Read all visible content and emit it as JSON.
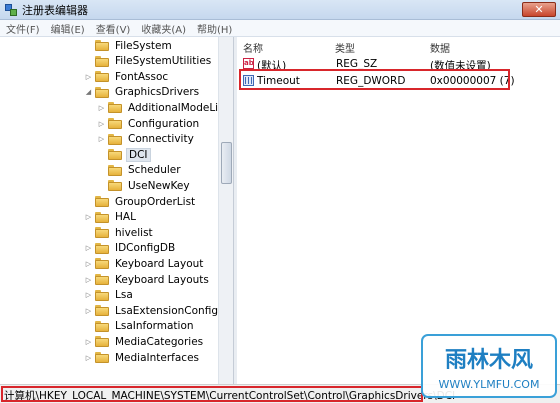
{
  "window": {
    "title": "注册表编辑器",
    "close_label": "✕"
  },
  "menu": [
    "文件(F)",
    "编辑(E)",
    "查看(V)",
    "收藏夹(A)",
    "帮助(H)"
  ],
  "tree": [
    {
      "label": "FileSystem",
      "level": 1,
      "expander": "",
      "selected": false
    },
    {
      "label": "FileSystemUtilities",
      "level": 1,
      "expander": "",
      "selected": false
    },
    {
      "label": "FontAssoc",
      "level": 1,
      "expander": "▷",
      "selected": false
    },
    {
      "label": "GraphicsDrivers",
      "level": 1,
      "expander": "◢",
      "selected": false
    },
    {
      "label": "AdditionalModeLists",
      "level": 2,
      "expander": "▷",
      "selected": false
    },
    {
      "label": "Configuration",
      "level": 2,
      "expander": "▷",
      "selected": false
    },
    {
      "label": "Connectivity",
      "level": 2,
      "expander": "▷",
      "selected": false
    },
    {
      "label": "DCI",
      "level": 2,
      "expander": "",
      "selected": true
    },
    {
      "label": "Scheduler",
      "level": 2,
      "expander": "",
      "selected": false
    },
    {
      "label": "UseNewKey",
      "level": 2,
      "expander": "",
      "selected": false
    },
    {
      "label": "GroupOrderList",
      "level": 1,
      "expander": "",
      "selected": false
    },
    {
      "label": "HAL",
      "level": 1,
      "expander": "▷",
      "selected": false
    },
    {
      "label": "hivelist",
      "level": 1,
      "expander": "",
      "selected": false
    },
    {
      "label": "IDConfigDB",
      "level": 1,
      "expander": "▷",
      "selected": false
    },
    {
      "label": "Keyboard Layout",
      "level": 1,
      "expander": "▷",
      "selected": false
    },
    {
      "label": "Keyboard Layouts",
      "level": 1,
      "expander": "▷",
      "selected": false
    },
    {
      "label": "Lsa",
      "level": 1,
      "expander": "▷",
      "selected": false
    },
    {
      "label": "LsaExtensionConfig",
      "level": 1,
      "expander": "▷",
      "selected": false
    },
    {
      "label": "LsaInformation",
      "level": 1,
      "expander": "",
      "selected": false
    },
    {
      "label": "MediaCategories",
      "level": 1,
      "expander": "▷",
      "selected": false
    },
    {
      "label": "MediaInterfaces",
      "level": 1,
      "expander": "▷",
      "selected": false
    }
  ],
  "columns": {
    "name": "名称",
    "type": "类型",
    "data": "数据"
  },
  "values": [
    {
      "icon": "string-value-icon",
      "glyph": "ab",
      "name": "(默认)",
      "type": "REG_SZ",
      "data": "(数值未设置)"
    },
    {
      "icon": "dword-value-icon",
      "glyph": "",
      "name": "Timeout",
      "type": "REG_DWORD",
      "data": "0x00000007 (7)"
    }
  ],
  "status": {
    "path": "计算机\\HKEY_LOCAL_MACHINE\\SYSTEM\\CurrentControlSet\\Control\\GraphicsDrivers\\DCI"
  },
  "watermark": {
    "brand": "雨林木风",
    "url": "WWW.YLMFU.COM"
  },
  "colors": {
    "highlight_border": "#d8262b",
    "title_bar": "#c6d8ee",
    "folder": "#e6b23c"
  }
}
